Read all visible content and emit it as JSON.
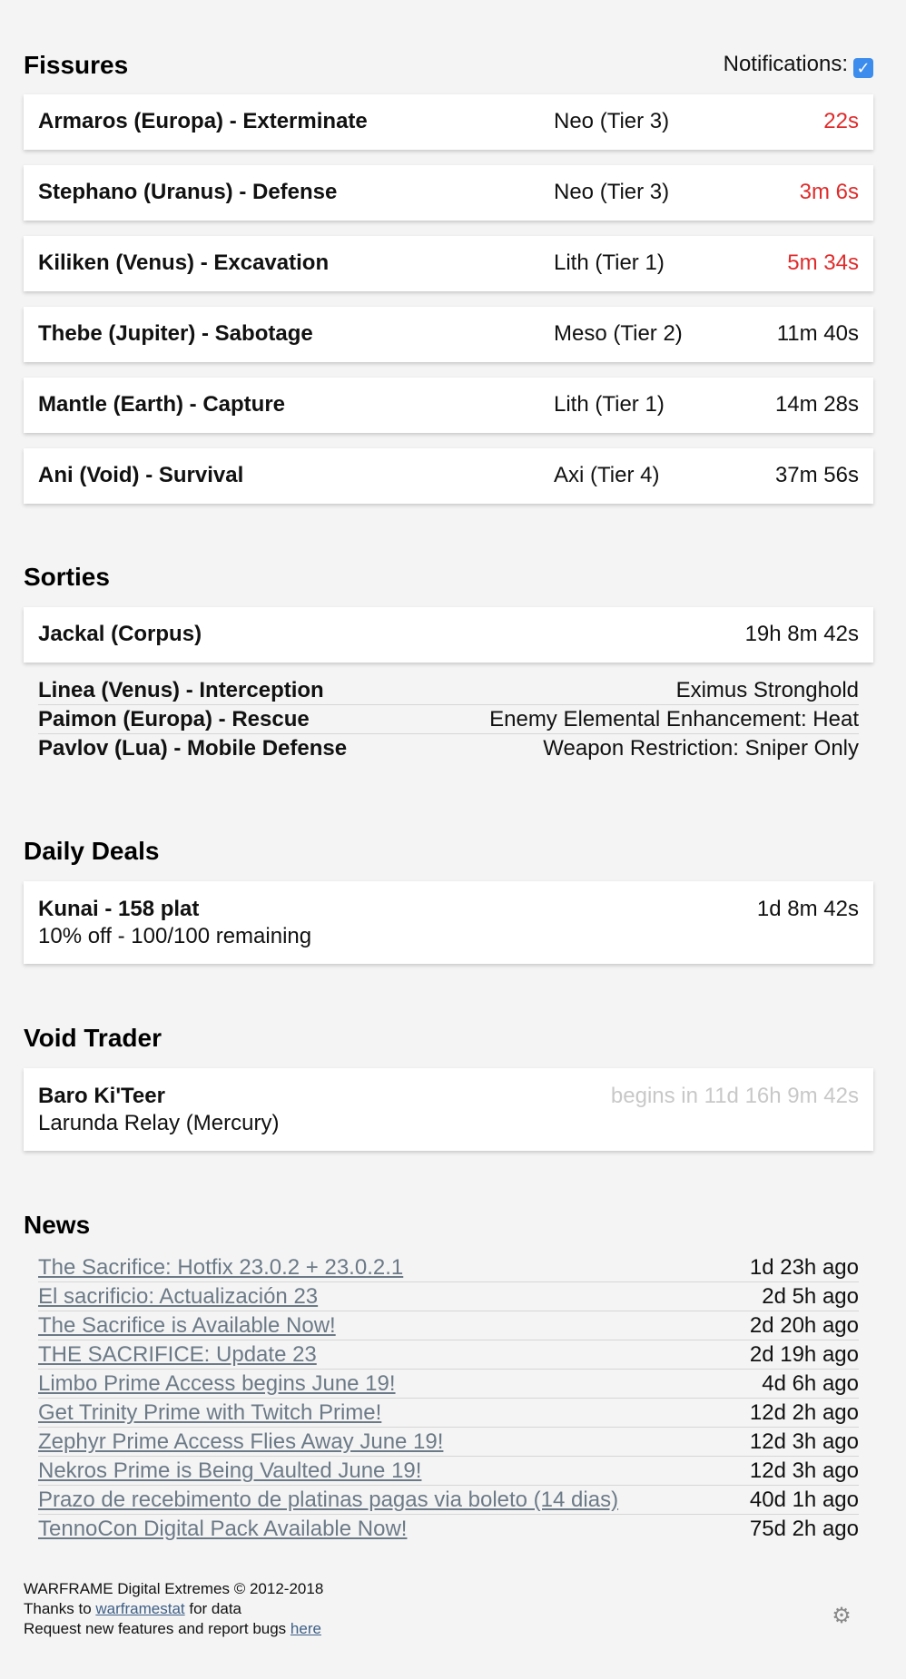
{
  "fissures": {
    "title": "Fissures",
    "notifications_label": "Notifications:",
    "notifications_checked": true,
    "items": [
      {
        "node": "Armaros (Europa) - Exterminate",
        "tier": "Neo (Tier 3)",
        "time": "22s",
        "urgent": true
      },
      {
        "node": "Stephano (Uranus) - Defense",
        "tier": "Neo (Tier 3)",
        "time": "3m 6s",
        "urgent": true
      },
      {
        "node": "Kiliken (Venus) - Excavation",
        "tier": "Lith (Tier 1)",
        "time": "5m 34s",
        "urgent": true
      },
      {
        "node": "Thebe (Jupiter) - Sabotage",
        "tier": "Meso (Tier 2)",
        "time": "11m 40s",
        "urgent": false
      },
      {
        "node": "Mantle (Earth) - Capture",
        "tier": "Lith (Tier 1)",
        "time": "14m 28s",
        "urgent": false
      },
      {
        "node": "Ani (Void) - Survival",
        "tier": "Axi (Tier 4)",
        "time": "37m 56s",
        "urgent": false
      }
    ]
  },
  "sorties": {
    "title": "Sorties",
    "boss": "Jackal (Corpus)",
    "time": "19h 8m 42s",
    "missions": [
      {
        "node": "Linea (Venus) - Interception",
        "condition": "Eximus Stronghold"
      },
      {
        "node": "Paimon (Europa) - Rescue",
        "condition": "Enemy Elemental Enhancement: Heat"
      },
      {
        "node": "Pavlov (Lua) - Mobile Defense",
        "condition": "Weapon Restriction: Sniper Only"
      }
    ]
  },
  "daily_deals": {
    "title": "Daily Deals",
    "item": "Kunai - 158 plat",
    "detail": "10% off - 100/100 remaining",
    "time": "1d 8m 42s"
  },
  "void_trader": {
    "title": "Void Trader",
    "name": "Baro Ki'Teer",
    "location": "Larunda Relay (Mercury)",
    "time": "begins in 11d 16h 9m 42s"
  },
  "news": {
    "title": "News",
    "items": [
      {
        "title": "The Sacrifice: Hotfix 23.0.2 + 23.0.2.1",
        "age": "1d 23h ago"
      },
      {
        "title": "El sacrificio: Actualización 23",
        "age": "2d 5h ago"
      },
      {
        "title": "The Sacrifice is Available Now!",
        "age": "2d 20h ago"
      },
      {
        "title": "THE SACRIFICE: Update 23",
        "age": "2d 19h ago"
      },
      {
        "title": "Limbo Prime Access begins June 19!",
        "age": "4d 6h ago"
      },
      {
        "title": "Get Trinity Prime with Twitch Prime!",
        "age": "12d 2h ago"
      },
      {
        "title": "Zephyr Prime Access Flies Away June 19!",
        "age": "12d 3h ago"
      },
      {
        "title": "Nekros Prime is Being Vaulted June 19!",
        "age": "12d 3h ago"
      },
      {
        "title": "Prazo de recebimento de platinas pagas via boleto (14 dias)",
        "age": "40d 1h ago"
      },
      {
        "title": "TennoCon Digital Pack Available Now!",
        "age": "75d 2h ago"
      }
    ]
  },
  "footer": {
    "copyright": "WARFRAME Digital Extremes © 2012-2018",
    "thanks_prefix": "Thanks to ",
    "thanks_link": "warframestat",
    "thanks_suffix": " for data",
    "request_prefix": "Request new features and report bugs ",
    "request_link": "here"
  },
  "colors": {
    "urgent": "#e02b2b",
    "checkbox": "#3b8ced",
    "link": "#6c7a87",
    "muted": "#c8c8c8"
  },
  "icons": {
    "settings": "gear-icon",
    "checkbox": "check-icon"
  }
}
